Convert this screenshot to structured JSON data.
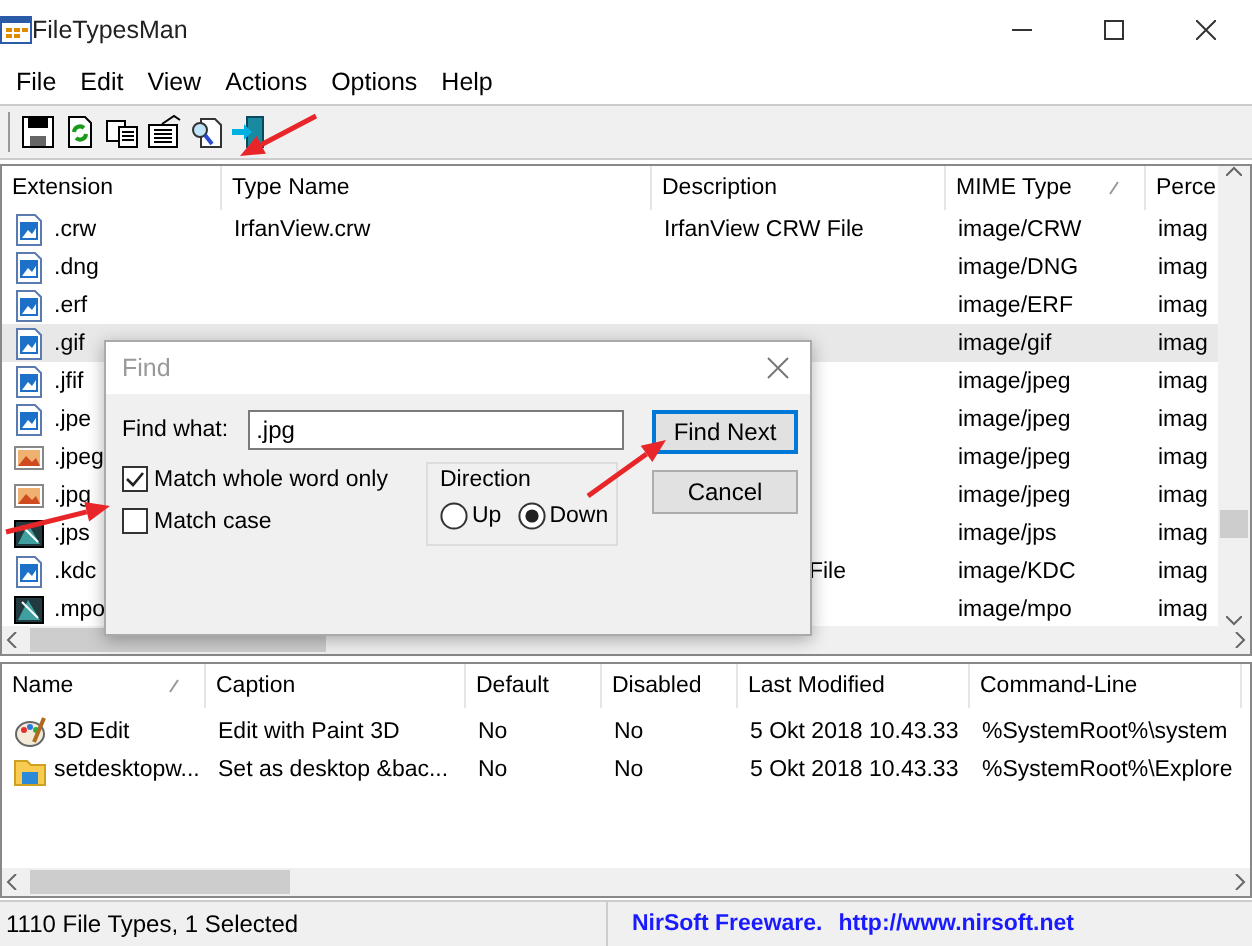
{
  "window": {
    "title": "FileTypesMan"
  },
  "menu": [
    "File",
    "Edit",
    "View",
    "Actions",
    "Options",
    "Help"
  ],
  "file_types": {
    "columns": [
      {
        "label": "Extension",
        "sorted": false
      },
      {
        "label": "Type Name",
        "sorted": false
      },
      {
        "label": "Description",
        "sorted": false
      },
      {
        "label": "MIME Type",
        "sorted": true
      },
      {
        "label": "Perce",
        "sorted": false
      }
    ],
    "rows": [
      {
        "kind": "document",
        "selected": false,
        "cells": [
          ".crw",
          "IrfanView.crw",
          "IrfanView CRW File",
          "image/CRW",
          "imag"
        ]
      },
      {
        "kind": "document",
        "selected": false,
        "cells": [
          ".dng",
          null,
          null,
          "image/DNG",
          "imag"
        ]
      },
      {
        "kind": "document",
        "selected": false,
        "cells": [
          ".erf",
          null,
          null,
          "image/ERF",
          "imag"
        ]
      },
      {
        "kind": "document",
        "selected": true,
        "cells": [
          ".gif",
          null,
          null,
          "image/gif",
          "imag"
        ]
      },
      {
        "kind": "document",
        "selected": false,
        "cells": [
          ".jfif",
          null,
          null,
          "image/jpeg",
          "imag"
        ]
      },
      {
        "kind": "document",
        "selected": false,
        "cells": [
          ".jpe",
          null,
          null,
          "image/jpeg",
          "imag"
        ]
      },
      {
        "kind": "photo",
        "selected": false,
        "cells": [
          ".jpeg",
          null,
          null,
          "image/jpeg",
          "imag"
        ]
      },
      {
        "kind": "photo",
        "selected": false,
        "cells": [
          ".jpg",
          null,
          null,
          "image/jpeg",
          "imag"
        ]
      },
      {
        "kind": "viewer",
        "selected": false,
        "cells": [
          ".jps",
          null,
          null,
          "image/jps",
          "imag"
        ]
      },
      {
        "kind": "document",
        "selected": false,
        "cells": [
          ".kdc",
          null,
          "File",
          "image/KDC",
          "imag"
        ]
      },
      {
        "kind": "viewer",
        "selected": false,
        "cells": [
          ".mpo",
          null,
          null,
          "image/mpo",
          "imag"
        ]
      }
    ]
  },
  "actions": {
    "columns": [
      {
        "label": "Name",
        "sorted": true
      },
      {
        "label": "Caption",
        "sorted": false
      },
      {
        "label": "Default",
        "sorted": false
      },
      {
        "label": "Disabled",
        "sorted": false
      },
      {
        "label": "Last Modified",
        "sorted": false
      },
      {
        "label": "Command-Line",
        "sorted": false
      }
    ],
    "rows": [
      {
        "kind": "palette",
        "selected": false,
        "cells": [
          "3D Edit",
          "Edit with Paint 3D",
          "No",
          "No",
          "5 Okt 2018 10.43.33",
          "%SystemRoot%\\system"
        ]
      },
      {
        "kind": "folder",
        "selected": false,
        "cells": [
          "setdesktopw...",
          "Set as desktop &bac...",
          "No",
          "No",
          "5 Okt 2018 10.43.33",
          "%SystemRoot%\\Explore"
        ]
      }
    ]
  },
  "status_bar": {
    "count": "1110 File Types, 1 Selected",
    "credit": "NirSoft Freeware.",
    "link": "http://www.nirsoft.net"
  },
  "find_dialog": {
    "title": "Find",
    "find_label": "Find what:",
    "value": ".jpg",
    "options": [
      {
        "label": "Match whole word only",
        "checked": true
      },
      {
        "label": "Match case",
        "checked": false
      }
    ],
    "direction": {
      "label": "Direction",
      "choices": [
        {
          "label": "Up",
          "selected": false
        },
        {
          "label": "Down",
          "selected": true
        }
      ]
    },
    "buttons": [
      {
        "label": "Find Next",
        "focused": true
      },
      {
        "label": "Cancel",
        "focused": false
      }
    ]
  }
}
